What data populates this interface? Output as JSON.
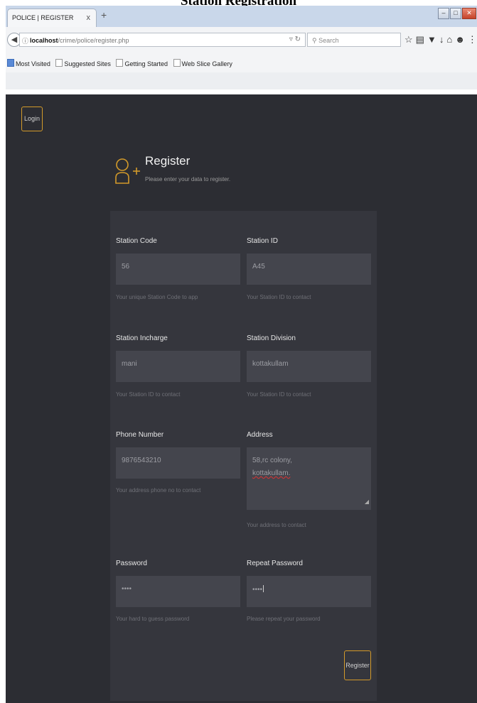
{
  "caption": "Station Registration",
  "browser": {
    "tab_title": "POLICE | REGISTER",
    "tab_close": "x",
    "new_tab": "+",
    "url_host": "localhost",
    "url_path": "/crime/police/register.php",
    "search_placeholder": "Search",
    "bookmarks": [
      "Most Visited",
      "Suggested Sites",
      "Getting Started",
      "Web Slice Gallery"
    ]
  },
  "page": {
    "login_label": "Login",
    "title": "Register",
    "subtitle": "Please enter your data to register.",
    "fields": {
      "station_code": {
        "label": "Station Code",
        "value": "56",
        "help": "Your unique Station Code to app"
      },
      "station_id": {
        "label": "Station ID",
        "value": "A45",
        "help": "Your Station ID to contact"
      },
      "station_incharge": {
        "label": "Station Incharge",
        "value": "mani",
        "help": "Your Station ID to contact"
      },
      "station_division": {
        "label": "Station Division",
        "value": "kottakullam",
        "help": "Your Station ID to contact"
      },
      "phone_number": {
        "label": "Phone Number",
        "value": "9876543210",
        "help": "Your address phone no to contact"
      },
      "address": {
        "label": "Address",
        "line1": "58,rc colony,",
        "line2": "kottakullam.",
        "help": "Your address to contact"
      },
      "password": {
        "label": "Password",
        "value": "••••",
        "help": "Your hard to guess password"
      },
      "repeat_password": {
        "label": "Repeat Password",
        "value": "••••",
        "help": "Please repeat your password"
      }
    },
    "register_label": "Register"
  },
  "colors": {
    "page_bg": "#2c2d33",
    "panel_bg": "#35363d",
    "input_bg": "#44454d",
    "accent": "#d39a2a"
  }
}
